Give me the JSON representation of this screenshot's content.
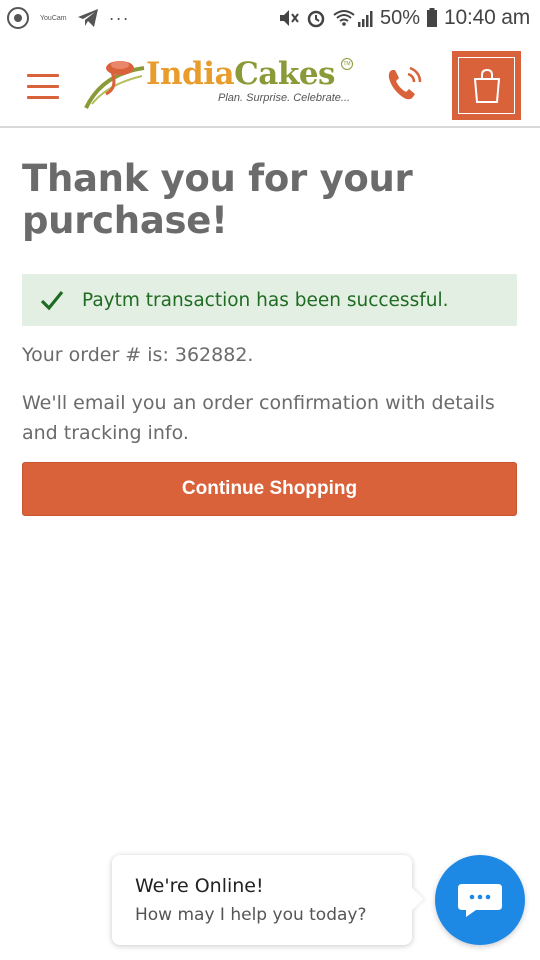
{
  "status_bar": {
    "tiny_text": "YouCam",
    "dots": "···",
    "battery_pct": "50%",
    "time": "10:40 am"
  },
  "header": {
    "logo_india": "India",
    "logo_cakes": "Cakes",
    "logo_tagline": "Plan. Surprise. Celebrate...",
    "logo_tm": "TM"
  },
  "main": {
    "title": "Thank you for your purchase!",
    "alert_text": "Paytm transaction has been successful.",
    "order_text": "Your order # is: 362882.",
    "note_text": "We'll email you an order confirmation with details and tracking info.",
    "button_label": "Continue Shopping"
  },
  "chat": {
    "title": "We're Online!",
    "subtitle": "How may I help you today?"
  },
  "colors": {
    "accent": "#d9623b",
    "success_bg": "#e4efe4",
    "success_text": "#1f6b22",
    "chat_blue": "#1e88e5"
  }
}
